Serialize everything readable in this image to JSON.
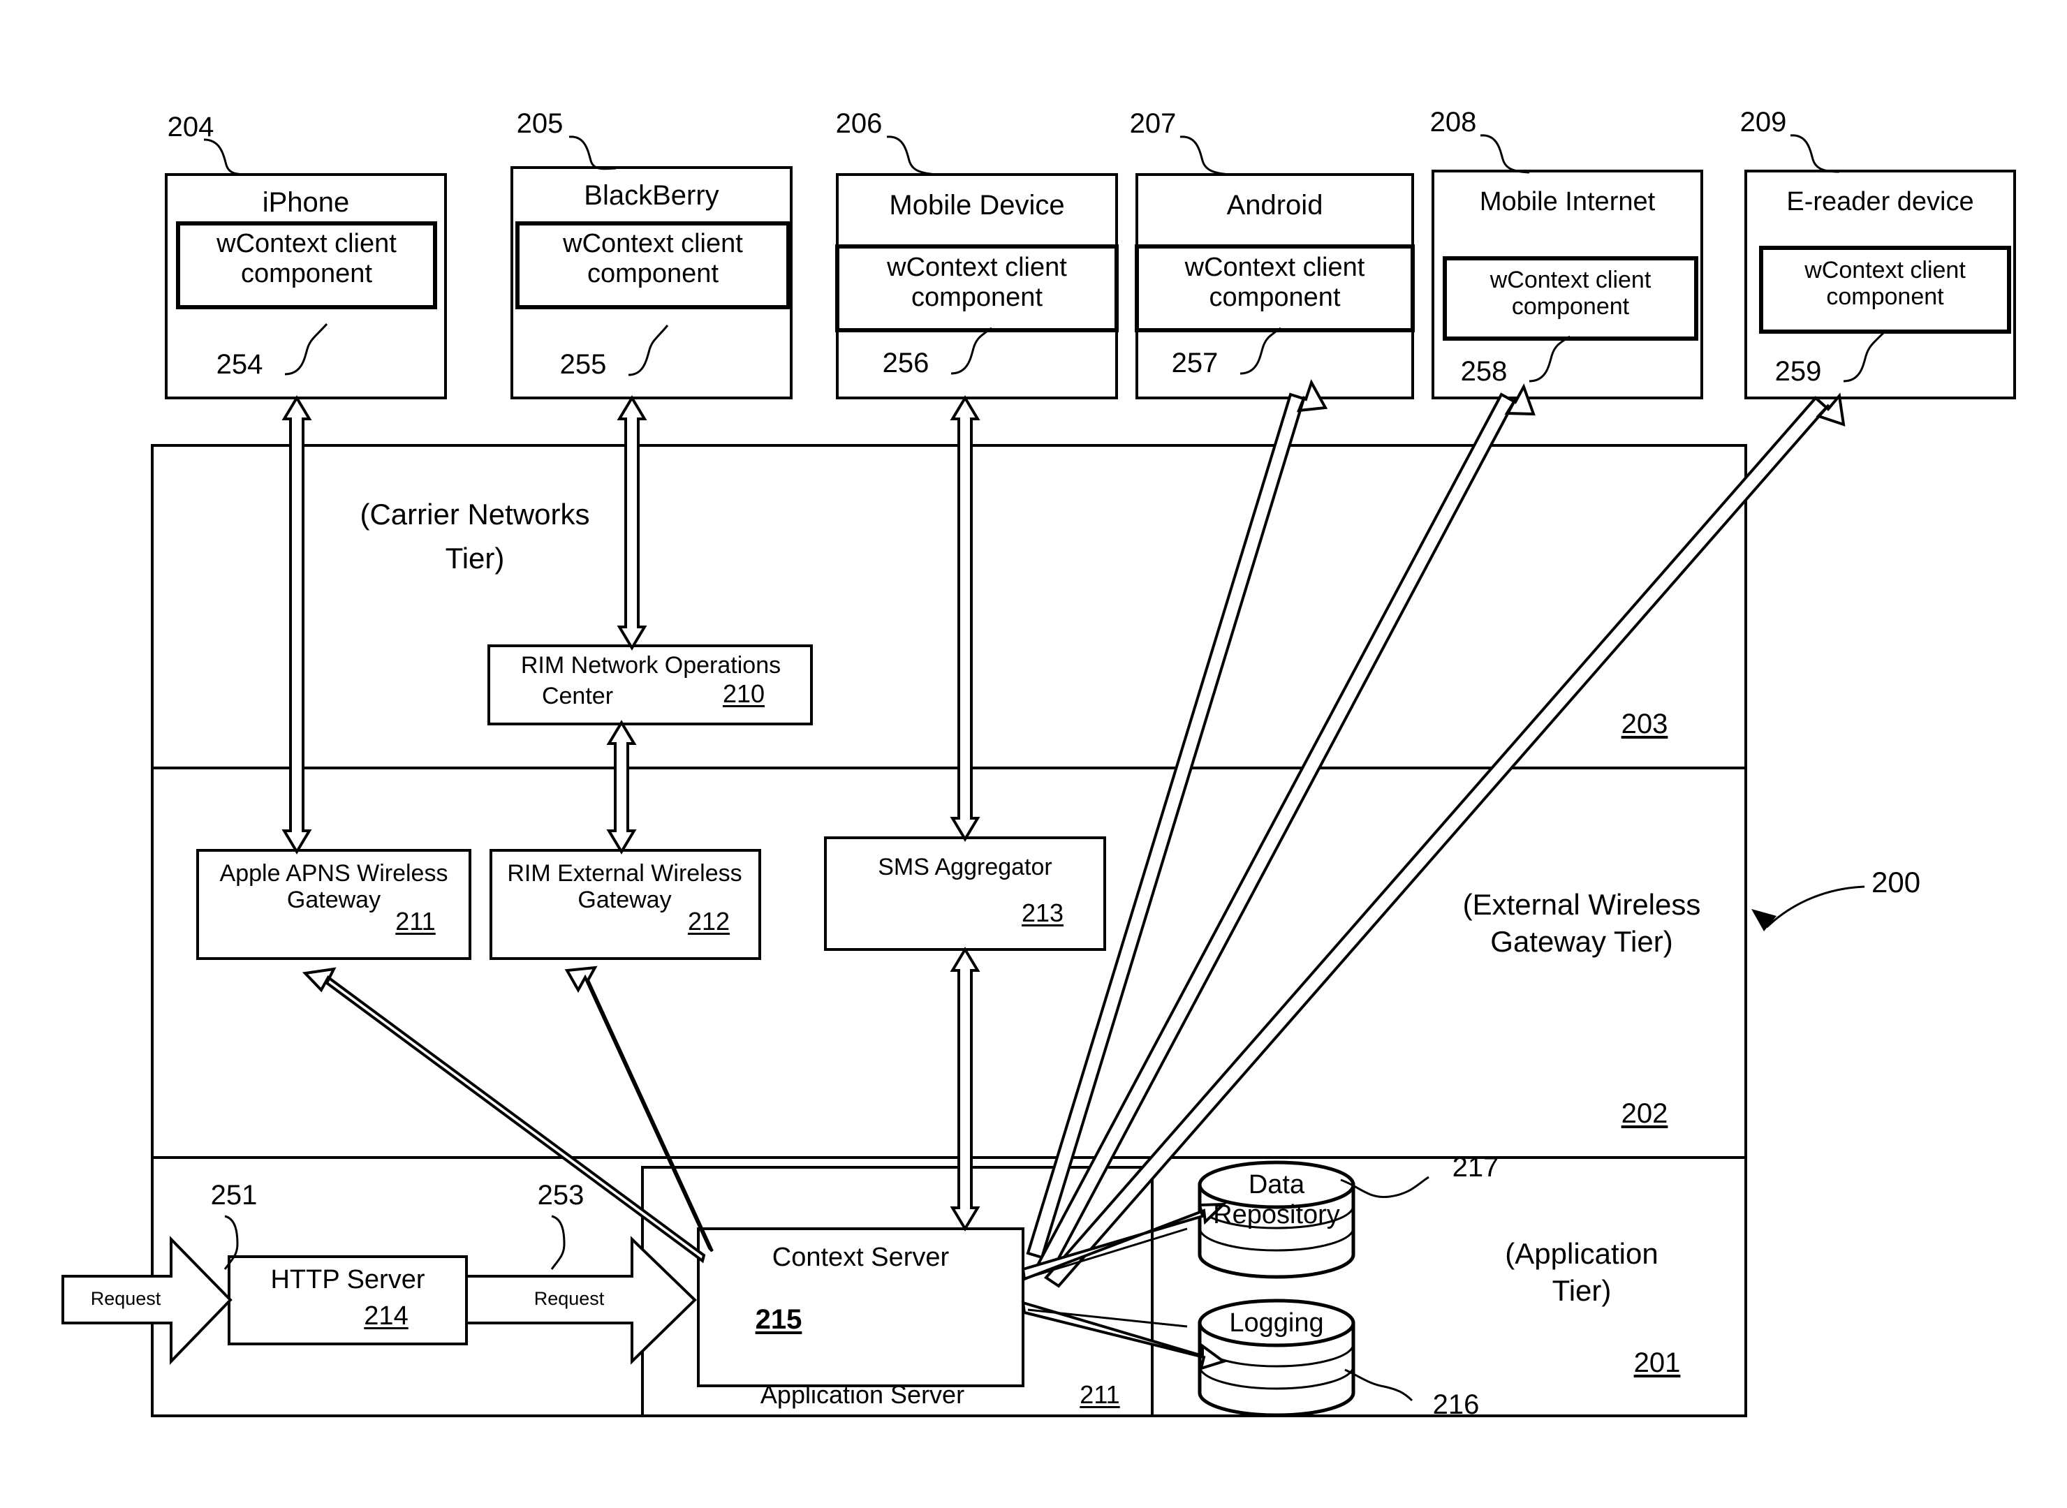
{
  "figure": {
    "system_ref": "200",
    "tiers": [
      {
        "ref": "203",
        "label": "(Carrier Networks\nTier)",
        "label_line1": "(Carrier Networks",
        "label_line2": "Tier)"
      },
      {
        "ref": "202",
        "label_line1": "(External Wireless",
        "label_line2": "Gateway Tier)"
      },
      {
        "ref": "201",
        "label_line1": "(Application",
        "label_line2": "Tier)"
      }
    ]
  },
  "devices": [
    {
      "ref": "204",
      "title": "iPhone",
      "component": "wContext client component",
      "component_ref": "254"
    },
    {
      "ref": "205",
      "title": "BlackBerry",
      "component": "wContext client component",
      "component_ref": "255"
    },
    {
      "ref": "206",
      "title": "Mobile Device",
      "component": "wContext client component",
      "component_ref": "256"
    },
    {
      "ref": "207",
      "title": "Android",
      "component": "wContext client component",
      "component_ref": "257"
    },
    {
      "ref": "208",
      "title": "Mobile Internet",
      "component": "wContext client component",
      "component_ref": "258"
    },
    {
      "ref": "209",
      "title": "E-reader device",
      "component": "wContext client component",
      "component_ref": "259"
    }
  ],
  "carrier_tier": {
    "nodes": [
      {
        "ref": "210",
        "line1": "RIM Network Operations",
        "line2": "Center"
      }
    ]
  },
  "gateway_tier": {
    "nodes": [
      {
        "ref": "211",
        "line1": "Apple APNS Wireless",
        "line2": "Gateway"
      },
      {
        "ref": "212",
        "line1": "RIM External Wireless",
        "line2": "Gateway"
      },
      {
        "ref": "213",
        "line1": "SMS Aggregator",
        "line2": ""
      }
    ]
  },
  "application_tier": {
    "http_server": {
      "label": "HTTP Server",
      "ref": "214"
    },
    "context_server": {
      "label": "Context Server",
      "ref": "215"
    },
    "app_server": {
      "label": "Application Server",
      "ref": "211"
    },
    "data_repository": {
      "label": "Data Repository",
      "ref": "217"
    },
    "logging": {
      "label": "Logging",
      "ref": "216"
    },
    "requests": [
      {
        "label": "Request",
        "ref": "251"
      },
      {
        "label": "Request",
        "ref": "253"
      }
    ]
  }
}
